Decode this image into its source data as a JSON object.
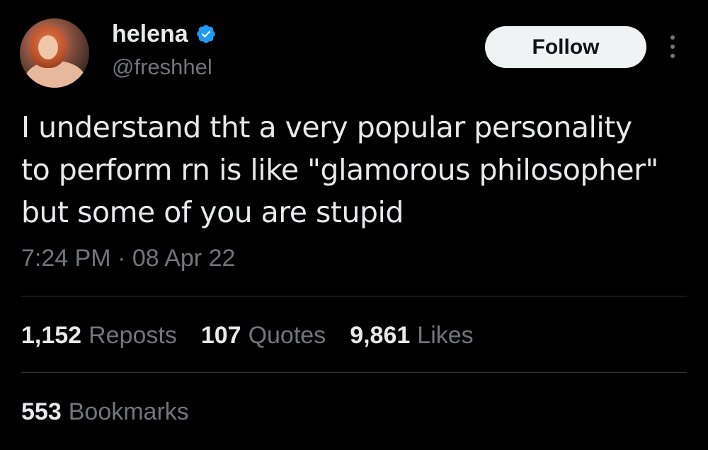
{
  "colors": {
    "background": "#000000",
    "text_primary": "#e7e9ea",
    "text_secondary": "#71767b",
    "verified_blue": "#1d9bf0",
    "follow_button_bg": "#eff3f4",
    "divider": "#2f3336"
  },
  "author": {
    "display_name": "helena",
    "handle": "@freshhel",
    "verified": true,
    "avatar_icon": "profile-photo"
  },
  "actions": {
    "follow_label": "Follow",
    "more_icon": "more-vertical-icon"
  },
  "tweet": {
    "text_lines": [
      "I understand tht a very popular personality",
      "to perform rn is like \"glamorous philosopher\"",
      "but some of you are stupid"
    ],
    "timestamp": "7:24 PM · 08 Apr 22"
  },
  "stats": {
    "reposts": {
      "count": "1,152",
      "label": "Reposts"
    },
    "quotes": {
      "count": "107",
      "label": "Quotes"
    },
    "likes": {
      "count": "9,861",
      "label": "Likes"
    },
    "bookmarks": {
      "count": "553",
      "label": "Bookmarks"
    }
  }
}
